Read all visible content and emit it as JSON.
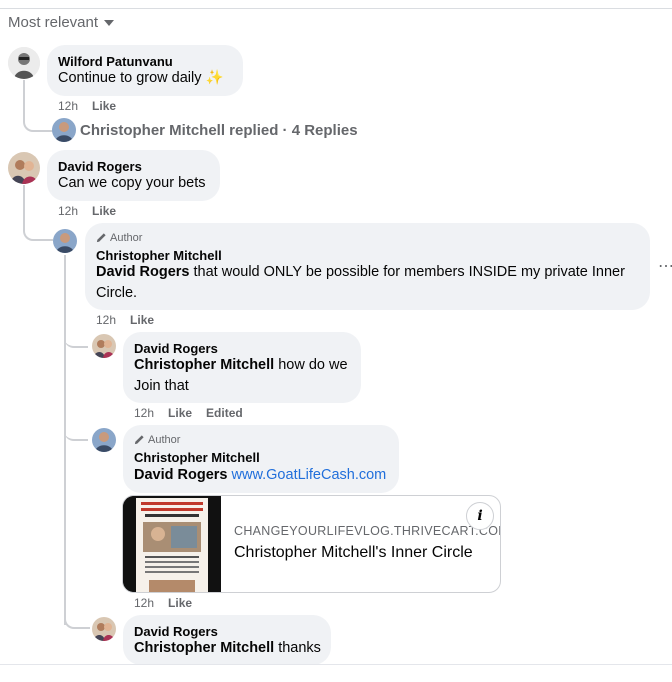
{
  "sort": {
    "label": "Most relevant",
    "icon": "caret-down-icon"
  },
  "comments": {
    "c1": {
      "author": "Wilford Patunvanu",
      "text": "Continue to grow daily ✨",
      "time": "12h",
      "like": "Like"
    },
    "c1_replies": {
      "avatar_name": "Christopher Mitchell",
      "label": "Christopher Mitchell replied · 4 Replies"
    },
    "c2": {
      "author": "David Rogers",
      "text": "Can we copy your bets",
      "time": "12h",
      "like": "Like"
    },
    "r1": {
      "badge": "Author",
      "author": "Christopher Mitchell",
      "mention": "David Rogers",
      "text": " that would ONLY be possible for members INSIDE my private Inner Circle.",
      "time": "12h",
      "like": "Like"
    },
    "r2": {
      "author": "David Rogers",
      "mention": "Christopher Mitchell",
      "text": " how do we Join that",
      "time": "12h",
      "like": "Like",
      "edited": "Edited"
    },
    "r3": {
      "badge": "Author",
      "author": "Christopher Mitchell",
      "mention": "David Rogers",
      "link": "www.GoatLifeCash.com",
      "time": "12h",
      "like": "Like",
      "card": {
        "domain": "CHANGEYOURLIFEVLOG.THRIVECART.COM",
        "title": "Christopher Mitchell's Inner Circle",
        "info": "i"
      }
    },
    "r4": {
      "author": "David Rogers",
      "mention": "Christopher Mitchell",
      "text": " thanks"
    }
  },
  "more_options": "⋯",
  "colors": {
    "bubble": "#f0f2f5",
    "link": "#216fdb",
    "secondary": "#65676b"
  }
}
